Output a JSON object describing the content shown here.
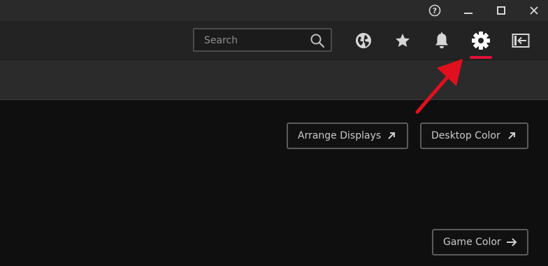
{
  "window": {
    "help_icon": "question-circle",
    "minimize_icon": "minimize",
    "maximize_icon": "maximize",
    "close_icon": "close"
  },
  "toolbar": {
    "search_label": "Search",
    "icons": [
      "globe-icon",
      "star-icon",
      "bell-icon",
      "gear-icon",
      "sidebar-collapse-icon"
    ],
    "active_item": "gear-icon",
    "accent_color": "#e0103a"
  },
  "main": {
    "buttons": {
      "arrange_displays": "Arrange Displays",
      "desktop_color": "Desktop Color",
      "game_color": "Game Color"
    }
  },
  "annotation": {
    "color": "#e0101e",
    "points_to": "gear-icon"
  }
}
